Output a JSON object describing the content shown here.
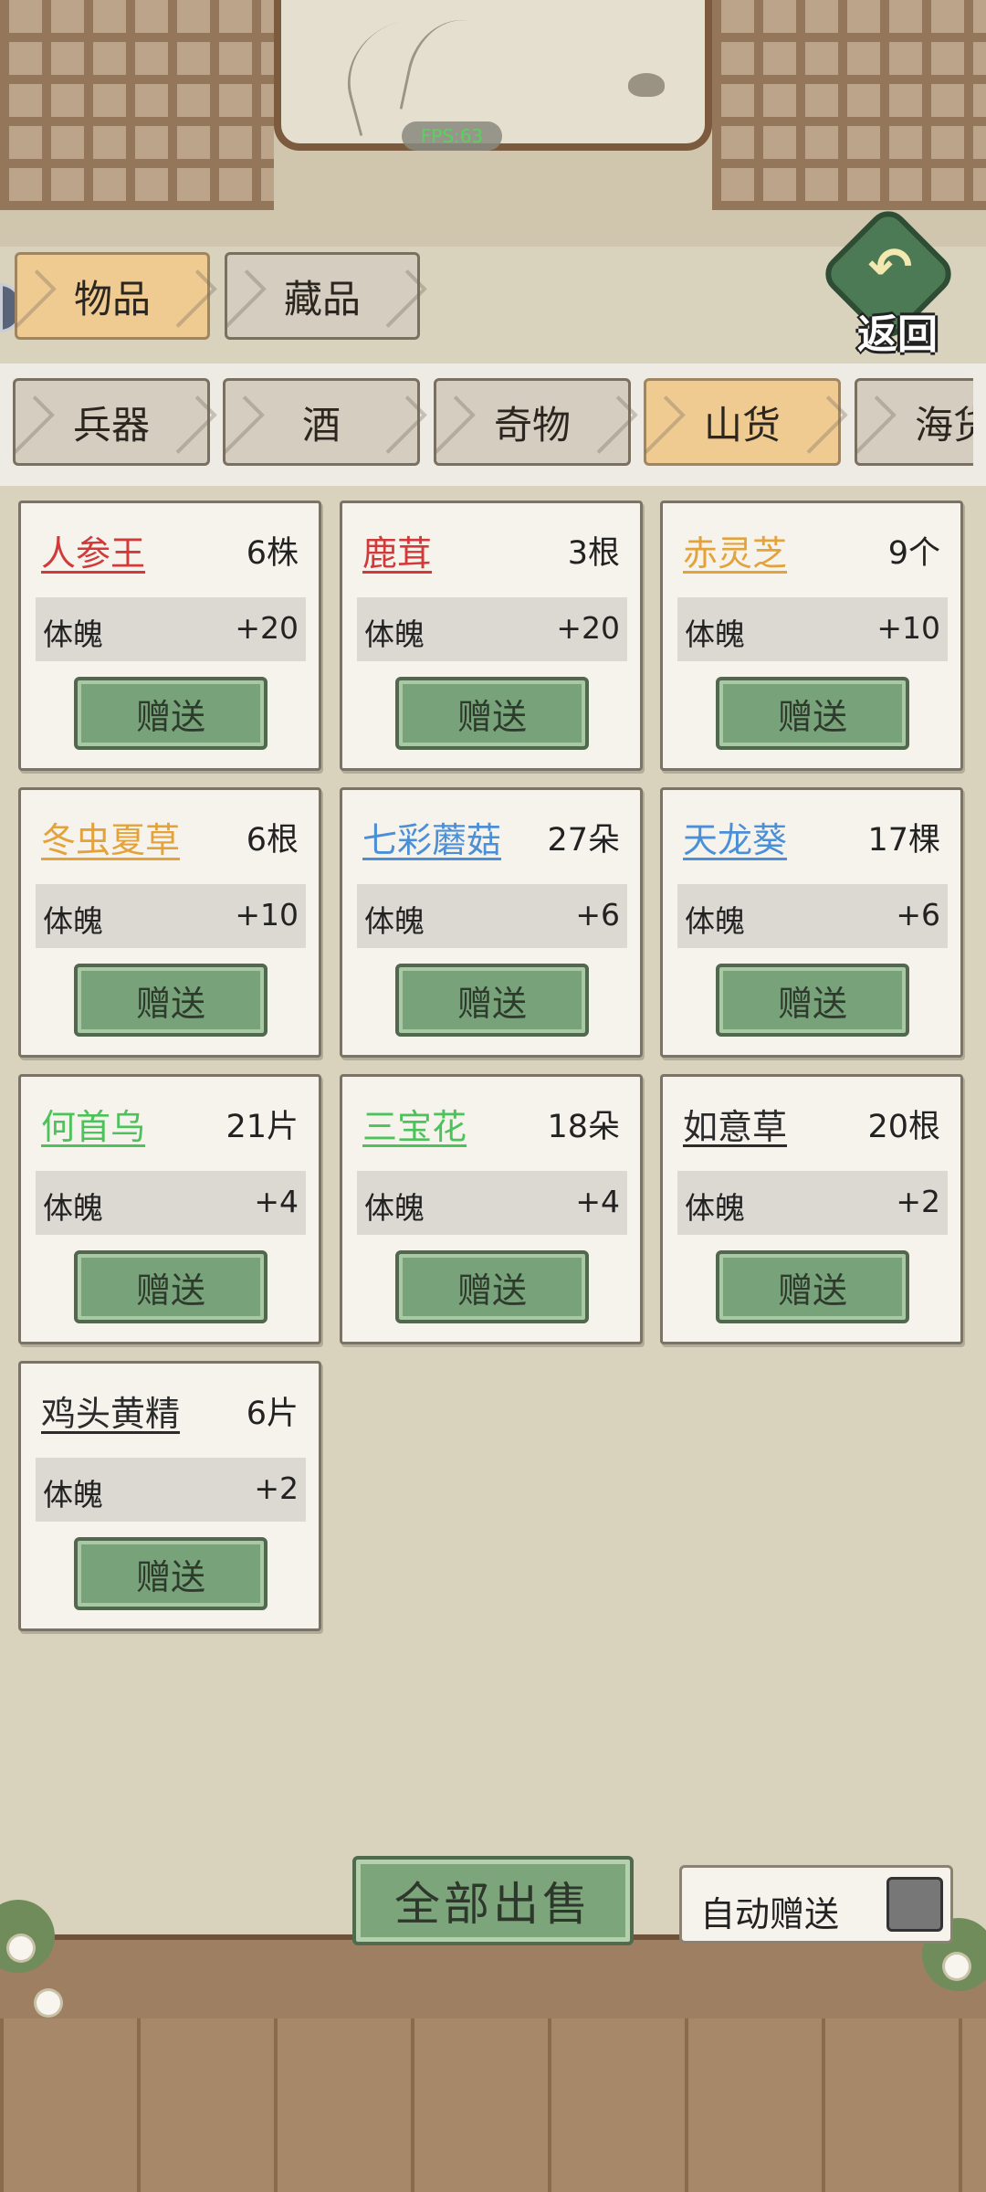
{
  "colors": {
    "rarity_red": "#d23a3a",
    "rarity_orange": "#e4a23a",
    "rarity_blue": "#4b8fd6",
    "rarity_green": "#4cc25a",
    "rarity_black": "#2b2b2b",
    "active_tab": "#efcb92",
    "button_green": "#78a37a"
  },
  "overlay": {
    "fps": "FPS:63"
  },
  "main_tabs": [
    {
      "label": "物品",
      "active": true
    },
    {
      "label": "藏品",
      "active": false
    }
  ],
  "return_button": {
    "label": "返回",
    "icon": "return-arrow-icon"
  },
  "category_tabs": [
    {
      "label": "兵器",
      "active": false
    },
    {
      "label": "酒",
      "active": false
    },
    {
      "label": "奇物",
      "active": false
    },
    {
      "label": "山货",
      "active": true
    },
    {
      "label": "海货",
      "active": false
    }
  ],
  "items": [
    {
      "name": "人参王",
      "qty": "6株",
      "stat": "体魄",
      "value": "+20",
      "button": "赠送",
      "rarity": "red"
    },
    {
      "name": "鹿茸",
      "qty": "3根",
      "stat": "体魄",
      "value": "+20",
      "button": "赠送",
      "rarity": "red"
    },
    {
      "name": "赤灵芝",
      "qty": "9个",
      "stat": "体魄",
      "value": "+10",
      "button": "赠送",
      "rarity": "orange"
    },
    {
      "name": "冬虫夏草",
      "qty": "6根",
      "stat": "体魄",
      "value": "+10",
      "button": "赠送",
      "rarity": "orange"
    },
    {
      "name": "七彩蘑菇",
      "qty": "27朵",
      "stat": "体魄",
      "value": "+6",
      "button": "赠送",
      "rarity": "blue"
    },
    {
      "name": "天龙葵",
      "qty": "17棵",
      "stat": "体魄",
      "value": "+6",
      "button": "赠送",
      "rarity": "blue"
    },
    {
      "name": "何首乌",
      "qty": "21片",
      "stat": "体魄",
      "value": "+4",
      "button": "赠送",
      "rarity": "green"
    },
    {
      "name": "三宝花",
      "qty": "18朵",
      "stat": "体魄",
      "value": "+4",
      "button": "赠送",
      "rarity": "green"
    },
    {
      "name": "如意草",
      "qty": "20根",
      "stat": "体魄",
      "value": "+2",
      "button": "赠送",
      "rarity": "black"
    },
    {
      "name": "鸡头黄精",
      "qty": "6片",
      "stat": "体魄",
      "value": "+2",
      "button": "赠送",
      "rarity": "black"
    }
  ],
  "footer": {
    "sell_all": "全部出售",
    "auto_gift": "自动赠送",
    "auto_gift_checked": false
  }
}
